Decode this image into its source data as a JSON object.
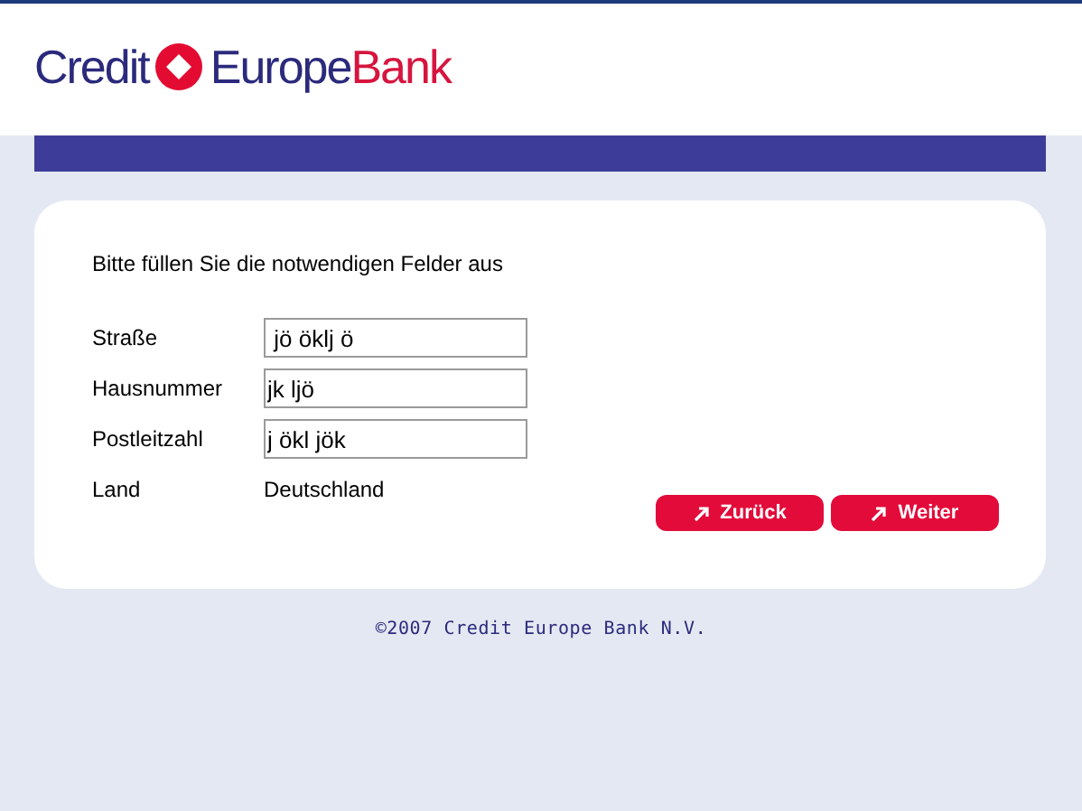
{
  "logo": {
    "word_1": "Credit",
    "word_2": "Europe",
    "word_3": "Bank"
  },
  "form": {
    "intro": "Bitte füllen Sie die notwendigen Felder aus",
    "fields": [
      {
        "kind": "input",
        "label": "Straße",
        "value": " jö öklj ö"
      },
      {
        "kind": "input",
        "label": "Hausnummer",
        "value": "jk ljö"
      },
      {
        "kind": "input",
        "label": "Postleitzahl",
        "value": "j ökl jök"
      },
      {
        "kind": "static",
        "label": "Land",
        "value": "Deutschland"
      }
    ],
    "buttons": [
      "Zurück",
      "Weiter"
    ]
  },
  "footer": "©2007 Credit Europe Bank N.V."
}
